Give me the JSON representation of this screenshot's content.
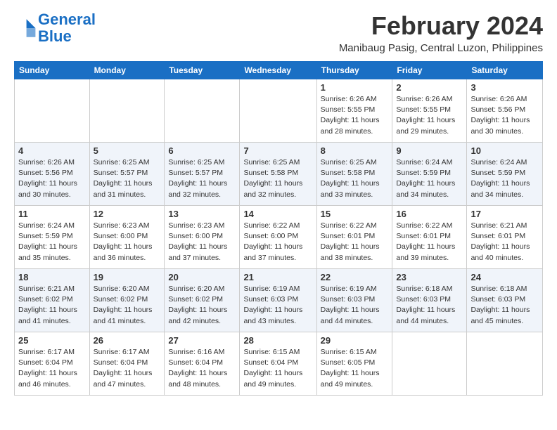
{
  "header": {
    "logo_line1": "General",
    "logo_line2": "Blue",
    "title": "February 2024",
    "subtitle": "Manibaug Pasig, Central Luzon, Philippines"
  },
  "weekdays": [
    "Sunday",
    "Monday",
    "Tuesday",
    "Wednesday",
    "Thursday",
    "Friday",
    "Saturday"
  ],
  "rows": [
    [
      {
        "day": "",
        "info": ""
      },
      {
        "day": "",
        "info": ""
      },
      {
        "day": "",
        "info": ""
      },
      {
        "day": "",
        "info": ""
      },
      {
        "day": "1",
        "info": "Sunrise: 6:26 AM\nSunset: 5:55 PM\nDaylight: 11 hours and 28 minutes."
      },
      {
        "day": "2",
        "info": "Sunrise: 6:26 AM\nSunset: 5:55 PM\nDaylight: 11 hours and 29 minutes."
      },
      {
        "day": "3",
        "info": "Sunrise: 6:26 AM\nSunset: 5:56 PM\nDaylight: 11 hours and 30 minutes."
      }
    ],
    [
      {
        "day": "4",
        "info": "Sunrise: 6:26 AM\nSunset: 5:56 PM\nDaylight: 11 hours and 30 minutes."
      },
      {
        "day": "5",
        "info": "Sunrise: 6:25 AM\nSunset: 5:57 PM\nDaylight: 11 hours and 31 minutes."
      },
      {
        "day": "6",
        "info": "Sunrise: 6:25 AM\nSunset: 5:57 PM\nDaylight: 11 hours and 32 minutes."
      },
      {
        "day": "7",
        "info": "Sunrise: 6:25 AM\nSunset: 5:58 PM\nDaylight: 11 hours and 32 minutes."
      },
      {
        "day": "8",
        "info": "Sunrise: 6:25 AM\nSunset: 5:58 PM\nDaylight: 11 hours and 33 minutes."
      },
      {
        "day": "9",
        "info": "Sunrise: 6:24 AM\nSunset: 5:59 PM\nDaylight: 11 hours and 34 minutes."
      },
      {
        "day": "10",
        "info": "Sunrise: 6:24 AM\nSunset: 5:59 PM\nDaylight: 11 hours and 34 minutes."
      }
    ],
    [
      {
        "day": "11",
        "info": "Sunrise: 6:24 AM\nSunset: 5:59 PM\nDaylight: 11 hours and 35 minutes."
      },
      {
        "day": "12",
        "info": "Sunrise: 6:23 AM\nSunset: 6:00 PM\nDaylight: 11 hours and 36 minutes."
      },
      {
        "day": "13",
        "info": "Sunrise: 6:23 AM\nSunset: 6:00 PM\nDaylight: 11 hours and 37 minutes."
      },
      {
        "day": "14",
        "info": "Sunrise: 6:22 AM\nSunset: 6:00 PM\nDaylight: 11 hours and 37 minutes."
      },
      {
        "day": "15",
        "info": "Sunrise: 6:22 AM\nSunset: 6:01 PM\nDaylight: 11 hours and 38 minutes."
      },
      {
        "day": "16",
        "info": "Sunrise: 6:22 AM\nSunset: 6:01 PM\nDaylight: 11 hours and 39 minutes."
      },
      {
        "day": "17",
        "info": "Sunrise: 6:21 AM\nSunset: 6:01 PM\nDaylight: 11 hours and 40 minutes."
      }
    ],
    [
      {
        "day": "18",
        "info": "Sunrise: 6:21 AM\nSunset: 6:02 PM\nDaylight: 11 hours and 41 minutes."
      },
      {
        "day": "19",
        "info": "Sunrise: 6:20 AM\nSunset: 6:02 PM\nDaylight: 11 hours and 41 minutes."
      },
      {
        "day": "20",
        "info": "Sunrise: 6:20 AM\nSunset: 6:02 PM\nDaylight: 11 hours and 42 minutes."
      },
      {
        "day": "21",
        "info": "Sunrise: 6:19 AM\nSunset: 6:03 PM\nDaylight: 11 hours and 43 minutes."
      },
      {
        "day": "22",
        "info": "Sunrise: 6:19 AM\nSunset: 6:03 PM\nDaylight: 11 hours and 44 minutes."
      },
      {
        "day": "23",
        "info": "Sunrise: 6:18 AM\nSunset: 6:03 PM\nDaylight: 11 hours and 44 minutes."
      },
      {
        "day": "24",
        "info": "Sunrise: 6:18 AM\nSunset: 6:03 PM\nDaylight: 11 hours and 45 minutes."
      }
    ],
    [
      {
        "day": "25",
        "info": "Sunrise: 6:17 AM\nSunset: 6:04 PM\nDaylight: 11 hours and 46 minutes."
      },
      {
        "day": "26",
        "info": "Sunrise: 6:17 AM\nSunset: 6:04 PM\nDaylight: 11 hours and 47 minutes."
      },
      {
        "day": "27",
        "info": "Sunrise: 6:16 AM\nSunset: 6:04 PM\nDaylight: 11 hours and 48 minutes."
      },
      {
        "day": "28",
        "info": "Sunrise: 6:15 AM\nSunset: 6:04 PM\nDaylight: 11 hours and 49 minutes."
      },
      {
        "day": "29",
        "info": "Sunrise: 6:15 AM\nSunset: 6:05 PM\nDaylight: 11 hours and 49 minutes."
      },
      {
        "day": "",
        "info": ""
      },
      {
        "day": "",
        "info": ""
      }
    ]
  ]
}
